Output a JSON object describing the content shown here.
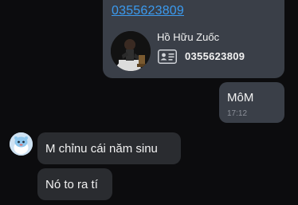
{
  "contact_message": {
    "link_text": "0355623809",
    "card": {
      "name": "Hồ Hữu Zuốc",
      "phone": "0355623809",
      "icon": "id-card-icon"
    }
  },
  "sent_message": {
    "text": "MôM",
    "time": "17:12"
  },
  "received_messages": [
    {
      "text": "M chỉnu cái năm sinu"
    },
    {
      "text": "Nó to ra tí"
    }
  ],
  "colors": {
    "background": "#0c0c0e",
    "outgoing_bubble": "#3a3f48",
    "incoming_bubble": "#2a2c30",
    "link": "#3b9bf0",
    "timestamp": "#8c9099"
  }
}
